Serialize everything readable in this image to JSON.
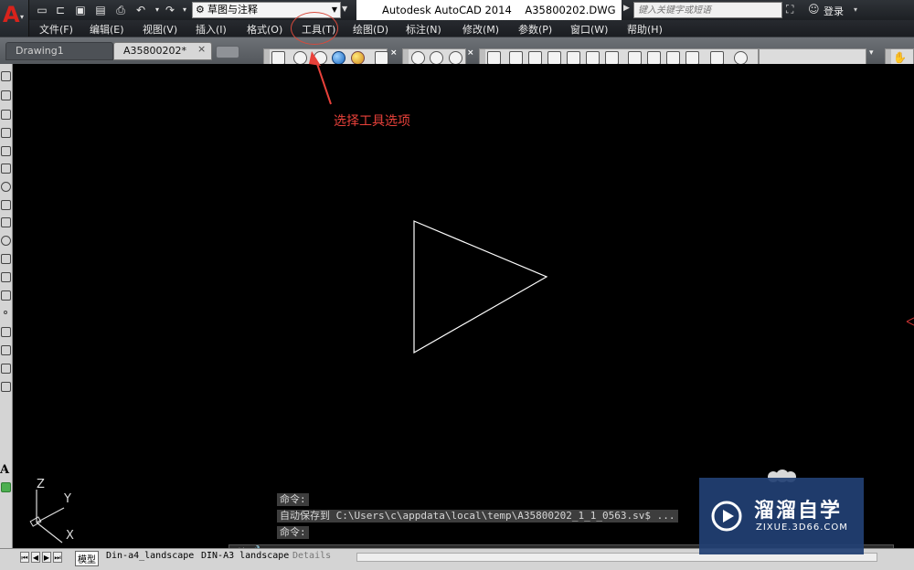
{
  "title_bar": {
    "workspace": "草图与注释",
    "app_title": "Autodesk AutoCAD 2014    A35800202.DWG",
    "search_placeholder": "键入关键字或短语",
    "login": "登录"
  },
  "menu": [
    "文件(F)",
    "编辑(E)",
    "视图(V)",
    "插入(I)",
    "格式(O)",
    "工具(T)",
    "绘图(D)",
    "标注(N)",
    "修改(M)",
    "参数(P)",
    "窗口(W)",
    "帮助(H)"
  ],
  "tabs": {
    "drawing1": "Drawing1",
    "current": "A35800202*",
    "close": "×"
  },
  "annotation": "选择工具选项",
  "command_lines": [
    "命令:",
    "自动保存到 C:\\Users\\c\\appdata\\local\\temp\\A35800202_1_1_0563.sv$ ...",
    "命令:"
  ],
  "ucs": {
    "x": "X",
    "y": "Y",
    "z": "Z"
  },
  "layout_tabs": [
    "模型",
    "Din-a4_landscape",
    "DIN-A3 landscape",
    "Details"
  ],
  "watermark": {
    "name": "溜溜自学",
    "url": "ZIXUE.3D66.COM"
  },
  "colors": {
    "annotation": "#e8413a",
    "watermark_bg": "#22407a"
  }
}
